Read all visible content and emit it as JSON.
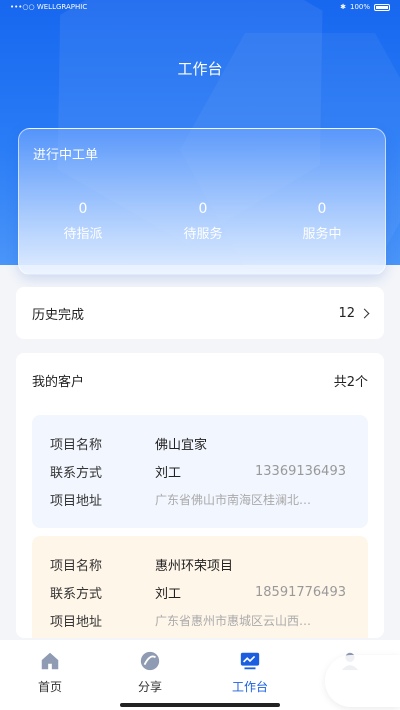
{
  "status_bar": {
    "carrier": "•••○○ WELLGRAPHIC",
    "battery": "100%"
  },
  "header": {
    "title": "工作台"
  },
  "work_orders": {
    "title": "进行中工单",
    "stats": [
      {
        "count": "0",
        "label": "待指派"
      },
      {
        "count": "0",
        "label": "待服务"
      },
      {
        "count": "0",
        "label": "服务中"
      }
    ]
  },
  "history": {
    "label": "历史完成",
    "count": "12"
  },
  "customers": {
    "title": "我的客户",
    "total": "共2个",
    "projects": [
      {
        "name_label": "项目名称",
        "name": "佛山宜家",
        "contact_label": "联系方式",
        "contact": "刘工",
        "phone": "13369136493",
        "addr_label": "项目地址",
        "address": "广东省佛山市南海区桂澜北…"
      },
      {
        "name_label": "项目名称",
        "name": "惠州环荣项目",
        "contact_label": "联系方式",
        "contact": "刘工",
        "phone": "18591776493",
        "addr_label": "项目地址",
        "address": "广东省惠州市惠城区云山西…"
      }
    ]
  },
  "tabs": [
    {
      "label": "首页",
      "icon": "home-icon"
    },
    {
      "label": "分享",
      "icon": "share-icon"
    },
    {
      "label": "工作台",
      "icon": "workbench-icon"
    },
    {
      "label": "",
      "icon": "user-icon"
    }
  ],
  "colors": {
    "primary": "#1b5fe0",
    "hero": "#1767ef",
    "blue_card": "#f2f6fe",
    "orange_card": "#fff6ea"
  }
}
